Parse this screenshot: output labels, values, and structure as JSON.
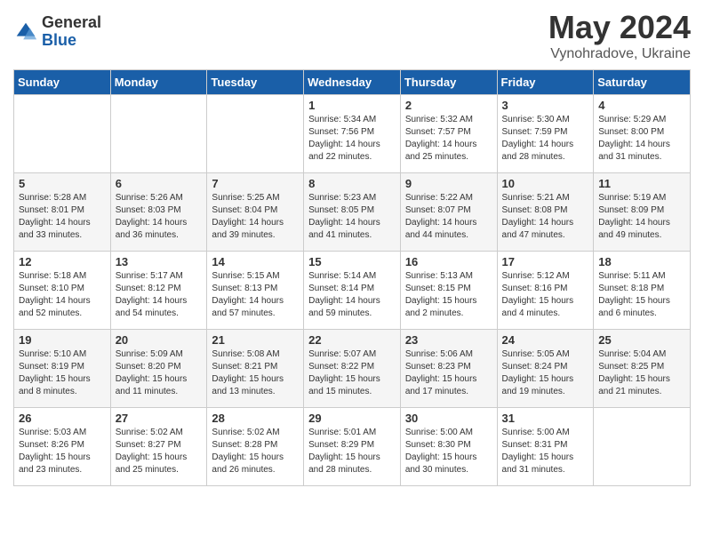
{
  "logo": {
    "general": "General",
    "blue": "Blue"
  },
  "title": {
    "month_year": "May 2024",
    "location": "Vynohradove, Ukraine"
  },
  "days_of_week": [
    "Sunday",
    "Monday",
    "Tuesday",
    "Wednesday",
    "Thursday",
    "Friday",
    "Saturday"
  ],
  "weeks": [
    [
      {
        "day": "",
        "info": ""
      },
      {
        "day": "",
        "info": ""
      },
      {
        "day": "",
        "info": ""
      },
      {
        "day": "1",
        "info": "Sunrise: 5:34 AM\nSunset: 7:56 PM\nDaylight: 14 hours\nand 22 minutes."
      },
      {
        "day": "2",
        "info": "Sunrise: 5:32 AM\nSunset: 7:57 PM\nDaylight: 14 hours\nand 25 minutes."
      },
      {
        "day": "3",
        "info": "Sunrise: 5:30 AM\nSunset: 7:59 PM\nDaylight: 14 hours\nand 28 minutes."
      },
      {
        "day": "4",
        "info": "Sunrise: 5:29 AM\nSunset: 8:00 PM\nDaylight: 14 hours\nand 31 minutes."
      }
    ],
    [
      {
        "day": "5",
        "info": "Sunrise: 5:28 AM\nSunset: 8:01 PM\nDaylight: 14 hours\nand 33 minutes."
      },
      {
        "day": "6",
        "info": "Sunrise: 5:26 AM\nSunset: 8:03 PM\nDaylight: 14 hours\nand 36 minutes."
      },
      {
        "day": "7",
        "info": "Sunrise: 5:25 AM\nSunset: 8:04 PM\nDaylight: 14 hours\nand 39 minutes."
      },
      {
        "day": "8",
        "info": "Sunrise: 5:23 AM\nSunset: 8:05 PM\nDaylight: 14 hours\nand 41 minutes."
      },
      {
        "day": "9",
        "info": "Sunrise: 5:22 AM\nSunset: 8:07 PM\nDaylight: 14 hours\nand 44 minutes."
      },
      {
        "day": "10",
        "info": "Sunrise: 5:21 AM\nSunset: 8:08 PM\nDaylight: 14 hours\nand 47 minutes."
      },
      {
        "day": "11",
        "info": "Sunrise: 5:19 AM\nSunset: 8:09 PM\nDaylight: 14 hours\nand 49 minutes."
      }
    ],
    [
      {
        "day": "12",
        "info": "Sunrise: 5:18 AM\nSunset: 8:10 PM\nDaylight: 14 hours\nand 52 minutes."
      },
      {
        "day": "13",
        "info": "Sunrise: 5:17 AM\nSunset: 8:12 PM\nDaylight: 14 hours\nand 54 minutes."
      },
      {
        "day": "14",
        "info": "Sunrise: 5:15 AM\nSunset: 8:13 PM\nDaylight: 14 hours\nand 57 minutes."
      },
      {
        "day": "15",
        "info": "Sunrise: 5:14 AM\nSunset: 8:14 PM\nDaylight: 14 hours\nand 59 minutes."
      },
      {
        "day": "16",
        "info": "Sunrise: 5:13 AM\nSunset: 8:15 PM\nDaylight: 15 hours\nand 2 minutes."
      },
      {
        "day": "17",
        "info": "Sunrise: 5:12 AM\nSunset: 8:16 PM\nDaylight: 15 hours\nand 4 minutes."
      },
      {
        "day": "18",
        "info": "Sunrise: 5:11 AM\nSunset: 8:18 PM\nDaylight: 15 hours\nand 6 minutes."
      }
    ],
    [
      {
        "day": "19",
        "info": "Sunrise: 5:10 AM\nSunset: 8:19 PM\nDaylight: 15 hours\nand 8 minutes."
      },
      {
        "day": "20",
        "info": "Sunrise: 5:09 AM\nSunset: 8:20 PM\nDaylight: 15 hours\nand 11 minutes."
      },
      {
        "day": "21",
        "info": "Sunrise: 5:08 AM\nSunset: 8:21 PM\nDaylight: 15 hours\nand 13 minutes."
      },
      {
        "day": "22",
        "info": "Sunrise: 5:07 AM\nSunset: 8:22 PM\nDaylight: 15 hours\nand 15 minutes."
      },
      {
        "day": "23",
        "info": "Sunrise: 5:06 AM\nSunset: 8:23 PM\nDaylight: 15 hours\nand 17 minutes."
      },
      {
        "day": "24",
        "info": "Sunrise: 5:05 AM\nSunset: 8:24 PM\nDaylight: 15 hours\nand 19 minutes."
      },
      {
        "day": "25",
        "info": "Sunrise: 5:04 AM\nSunset: 8:25 PM\nDaylight: 15 hours\nand 21 minutes."
      }
    ],
    [
      {
        "day": "26",
        "info": "Sunrise: 5:03 AM\nSunset: 8:26 PM\nDaylight: 15 hours\nand 23 minutes."
      },
      {
        "day": "27",
        "info": "Sunrise: 5:02 AM\nSunset: 8:27 PM\nDaylight: 15 hours\nand 25 minutes."
      },
      {
        "day": "28",
        "info": "Sunrise: 5:02 AM\nSunset: 8:28 PM\nDaylight: 15 hours\nand 26 minutes."
      },
      {
        "day": "29",
        "info": "Sunrise: 5:01 AM\nSunset: 8:29 PM\nDaylight: 15 hours\nand 28 minutes."
      },
      {
        "day": "30",
        "info": "Sunrise: 5:00 AM\nSunset: 8:30 PM\nDaylight: 15 hours\nand 30 minutes."
      },
      {
        "day": "31",
        "info": "Sunrise: 5:00 AM\nSunset: 8:31 PM\nDaylight: 15 hours\nand 31 minutes."
      },
      {
        "day": "",
        "info": ""
      }
    ]
  ]
}
